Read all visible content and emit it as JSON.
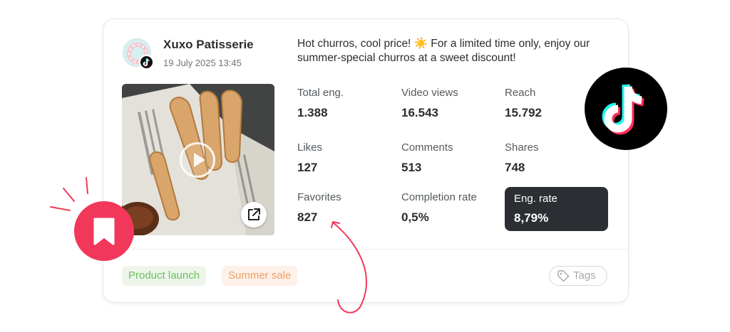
{
  "post": {
    "author": "Xuxo Patisserie",
    "date": "19 July 2025 13:45",
    "caption": "Hot churros, cool price! ☀️ For a limited time only, enjoy our summer-special churros at a sweet discount!",
    "network_icon": "tiktok-icon"
  },
  "metrics": {
    "total_eng": {
      "label": "Total eng.",
      "value": "1.388"
    },
    "video_views": {
      "label": "Video views",
      "value": "16.543"
    },
    "reach": {
      "label": "Reach",
      "value": "15.792"
    },
    "likes": {
      "label": "Likes",
      "value": "127"
    },
    "comments": {
      "label": "Comments",
      "value": "513"
    },
    "shares": {
      "label": "Shares",
      "value": "748"
    },
    "favorites": {
      "label": "Favorites",
      "value": "827"
    },
    "completion_rate": {
      "label": "Completion rate",
      "value": "0,5%"
    },
    "eng_rate": {
      "label": "Eng. rate",
      "value": "8,79%"
    }
  },
  "tags": [
    {
      "label": "Product launch",
      "bg": "#eef6ec",
      "color": "#6cbf5a"
    },
    {
      "label": "Summer sale",
      "bg": "#fdf1e9",
      "color": "#f0a066"
    }
  ],
  "tags_button": {
    "label": "Tags",
    "icon": "tag-icon"
  },
  "icons": {
    "play": "play-icon",
    "external": "external-link-icon",
    "bookmark": "bookmark-icon",
    "tiktok": "tiktok-logo"
  },
  "colors": {
    "accent": "#f2385a",
    "eng_box": "#2b2f33",
    "tiktok_cyan": "#25f4ee",
    "tiktok_red": "#fe2c55"
  }
}
